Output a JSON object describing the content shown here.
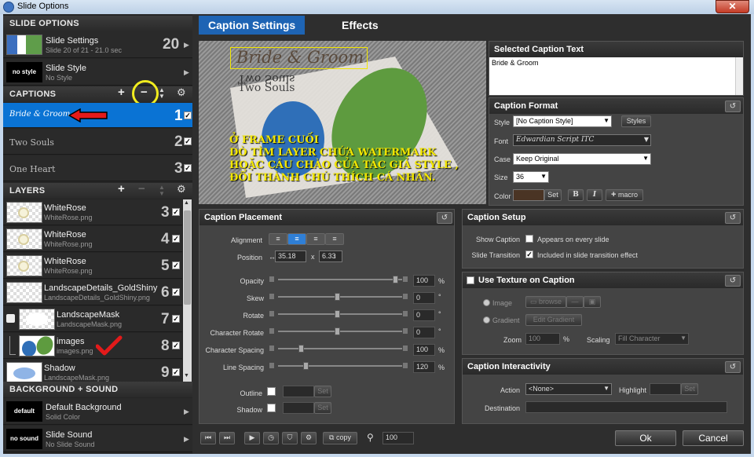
{
  "window": {
    "title": "Slide Options"
  },
  "left": {
    "slide_options_header": "SLIDE OPTIONS",
    "slide_settings": {
      "title": "Slide Settings",
      "sub": "Slide 20 of 21 - 21.0 sec",
      "num": "20"
    },
    "slide_style": {
      "title": "Slide Style",
      "sub": "No Style",
      "thumb": "no style"
    },
    "captions_header": "CAPTIONS",
    "captions": [
      {
        "text": "Bride & Groom",
        "num": "1"
      },
      {
        "text": "Two Souls",
        "num": "2"
      },
      {
        "text": "One Heart",
        "num": "3"
      }
    ],
    "layers_header": "LAYERS",
    "layers": [
      {
        "title": "WhiteRose",
        "sub": "WhiteRose.png",
        "num": "3"
      },
      {
        "title": "WhiteRose",
        "sub": "WhiteRose.png",
        "num": "4"
      },
      {
        "title": "WhiteRose",
        "sub": "WhiteRose.png",
        "num": "5"
      },
      {
        "title": "LandscapeDetails_GoldShiny",
        "sub": "LandscapeDetails_GoldShiny.png",
        "num": "6"
      },
      {
        "title": "LandscapeMask",
        "sub": "LandscapeMask.png",
        "num": "7"
      },
      {
        "title": "images",
        "sub": "images.png",
        "num": "8"
      },
      {
        "title": "Shadow",
        "sub": "LandscapeMask.png",
        "num": "9"
      }
    ],
    "bg_header": "BACKGROUND + SOUND",
    "default_bg": {
      "title": "Default Background",
      "sub": "Solid Color",
      "thumb": "default"
    },
    "slide_sound": {
      "title": "Slide Sound",
      "sub": "No Slide Sound",
      "thumb": "no sound"
    }
  },
  "tabs": [
    {
      "label": "Caption Settings"
    },
    {
      "label": "Effects"
    }
  ],
  "preview": {
    "caption_main": "Bride & Groom",
    "caption_alt1": "Two Souls",
    "caption_alt2": "Two Souls",
    "overlay_note": "Ở FRAME CUỐI\nDÒ TÌM LAYER CHỨA WATERMARK\nHOẶC CÂU CHÀO CỦA TÁC GIẢ STYLE ,\nĐỔI THÀNH CHÚ THÍCH CÁ NHÂN."
  },
  "selected_caption": {
    "header": "Selected Caption Text",
    "text": "Bride & Groom"
  },
  "caption_format": {
    "header": "Caption Format",
    "style_label": "Style",
    "style_value": "[No Caption Style]",
    "styles_btn": "Styles",
    "font_label": "Font",
    "font_value": "Edwardian Script ITC",
    "case_label": "Case",
    "case_value": "Keep Original",
    "size_label": "Size",
    "size_value": "36",
    "color_label": "Color",
    "set_btn": "Set",
    "bold": "B",
    "italic": "I",
    "macro": "macro",
    "color_swatch": "#4a3424"
  },
  "placement": {
    "header": "Caption Placement",
    "alignment_label": "Alignment",
    "position_label": "Position",
    "pos_x": "35.18",
    "pos_sep": "x",
    "pos_y": "6.33",
    "rows": [
      {
        "label": "Opacity",
        "value": "100",
        "unit": "%"
      },
      {
        "label": "Skew",
        "value": "0",
        "unit": "°"
      },
      {
        "label": "Rotate",
        "value": "0",
        "unit": "°"
      },
      {
        "label": "Character Rotate",
        "value": "0",
        "unit": "°"
      },
      {
        "label": "Character Spacing",
        "value": "100",
        "unit": "%"
      },
      {
        "label": "Line Spacing",
        "value": "120",
        "unit": "%"
      }
    ],
    "outline_label": "Outline",
    "shadow_label": "Shadow",
    "set": "Set"
  },
  "setup": {
    "header": "Caption Setup",
    "show_caption_label": "Show Caption",
    "show_caption_text": "Appears on every slide",
    "transition_label": "Slide Transition",
    "transition_text": "Included in slide transition effect"
  },
  "texture": {
    "header": "Use Texture on Caption",
    "image": "Image",
    "browse": "browse",
    "gradient": "Gradient",
    "edit_gradient": "Edit Gradient",
    "zoom_label": "Zoom",
    "zoom_value": "100",
    "zoom_unit": "%",
    "scaling_label": "Scaling",
    "scaling_value": "Fill Character"
  },
  "interactivity": {
    "header": "Caption Interactivity",
    "action_label": "Action",
    "action_value": "<None>",
    "highlight_label": "Highlight",
    "set": "Set",
    "destination_label": "Destination"
  },
  "bottom": {
    "copy": "copy",
    "zoom": "100",
    "ok": "Ok",
    "cancel": "Cancel"
  }
}
